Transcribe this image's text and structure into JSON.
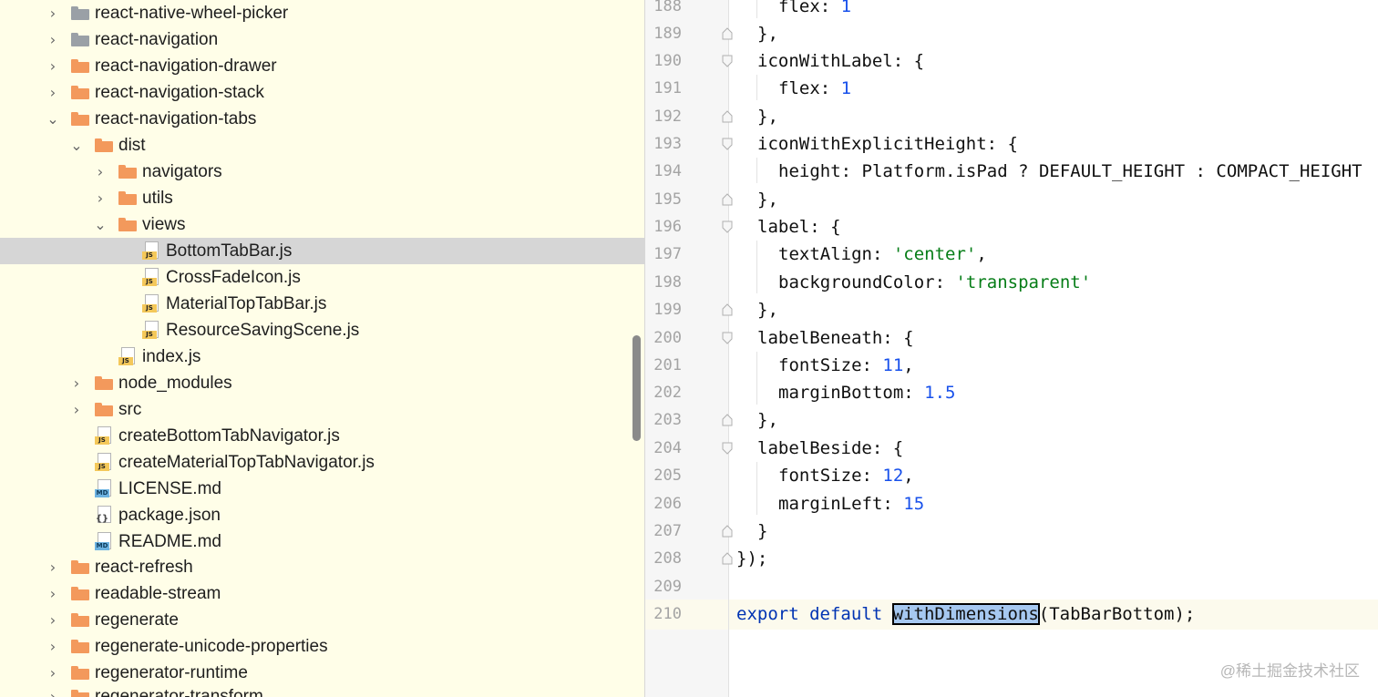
{
  "project_tree": {
    "items": [
      {
        "label": "react-native-wheel-picker",
        "icon": "folder-gray",
        "chevron": "collapsed"
      },
      {
        "label": "react-navigation",
        "icon": "folder-gray",
        "chevron": "collapsed"
      },
      {
        "label": "react-navigation-drawer",
        "icon": "folder",
        "chevron": "collapsed"
      },
      {
        "label": "react-navigation-stack",
        "icon": "folder",
        "chevron": "collapsed"
      },
      {
        "label": "react-navigation-tabs",
        "icon": "folder",
        "chevron": "expanded"
      },
      {
        "label": "dist",
        "icon": "folder",
        "chevron": "expanded"
      },
      {
        "label": "navigators",
        "icon": "folder",
        "chevron": "collapsed"
      },
      {
        "label": "utils",
        "icon": "folder",
        "chevron": "collapsed"
      },
      {
        "label": "views",
        "icon": "folder",
        "chevron": "expanded"
      },
      {
        "label": "BottomTabBar.js",
        "icon": "js-file",
        "chevron": "none",
        "selected": true
      },
      {
        "label": "CrossFadeIcon.js",
        "icon": "js-file",
        "chevron": "none"
      },
      {
        "label": "MaterialTopTabBar.js",
        "icon": "js-file",
        "chevron": "none"
      },
      {
        "label": "ResourceSavingScene.js",
        "icon": "js-file",
        "chevron": "none"
      },
      {
        "label": "index.js",
        "icon": "js-file",
        "chevron": "none"
      },
      {
        "label": "node_modules",
        "icon": "folder",
        "chevron": "collapsed"
      },
      {
        "label": "src",
        "icon": "folder",
        "chevron": "collapsed"
      },
      {
        "label": "createBottomTabNavigator.js",
        "icon": "js-file",
        "chevron": "none"
      },
      {
        "label": "createMaterialTopTabNavigator.js",
        "icon": "js-file",
        "chevron": "none"
      },
      {
        "label": "LICENSE.md",
        "icon": "md-file",
        "chevron": "none"
      },
      {
        "label": "package.json",
        "icon": "json-file",
        "chevron": "none"
      },
      {
        "label": "README.md",
        "icon": "md-file",
        "chevron": "none"
      },
      {
        "label": "react-refresh",
        "icon": "folder",
        "chevron": "collapsed"
      },
      {
        "label": "readable-stream",
        "icon": "folder",
        "chevron": "collapsed"
      },
      {
        "label": "regenerate",
        "icon": "folder",
        "chevron": "collapsed"
      },
      {
        "label": "regenerate-unicode-properties",
        "icon": "folder",
        "chevron": "collapsed"
      },
      {
        "label": "regenerator-runtime",
        "icon": "folder",
        "chevron": "collapsed"
      },
      {
        "label": "regenerator-transform",
        "icon": "folder",
        "chevron": "collapsed"
      }
    ]
  },
  "editor": {
    "lines": [
      {
        "num": "188",
        "text": "flex: 1"
      },
      {
        "num": "189",
        "text": "},"
      },
      {
        "num": "190",
        "text": "iconWithLabel: {"
      },
      {
        "num": "191",
        "text": "flex: 1"
      },
      {
        "num": "192",
        "text": "},"
      },
      {
        "num": "193",
        "text": "iconWithExplicitHeight: {"
      },
      {
        "num": "194",
        "text": "height: Platform.isPad ? DEFAULT_HEIGHT : COMPACT_HEIGHT"
      },
      {
        "num": "195",
        "text": "},"
      },
      {
        "num": "196",
        "text": "label: {"
      },
      {
        "num": "197",
        "text": "textAlign: 'center',"
      },
      {
        "num": "198",
        "text": "backgroundColor: 'transparent'"
      },
      {
        "num": "199",
        "text": "},"
      },
      {
        "num": "200",
        "text": "labelBeneath: {"
      },
      {
        "num": "201",
        "text": "fontSize: 11,"
      },
      {
        "num": "202",
        "text": "marginBottom: 1.5"
      },
      {
        "num": "203",
        "text": "},"
      },
      {
        "num": "204",
        "text": "labelBeside: {"
      },
      {
        "num": "205",
        "text": "fontSize: 12,"
      },
      {
        "num": "206",
        "text": "marginLeft: 15"
      },
      {
        "num": "207",
        "text": "}"
      },
      {
        "num": "208",
        "text": "});"
      },
      {
        "num": "209",
        "text": ""
      },
      {
        "num": "210",
        "text": "export default withDimensions(TabBarBottom);"
      }
    ],
    "highlighted_word": "withDimensions"
  },
  "watermark": "@稀土掘金技术社区",
  "colors": {
    "tree_background": "#fffee8",
    "selection": "#d6d6d6",
    "folder": "#f3995c",
    "folder_gray": "#9aa0a6",
    "keyword": "#0033b3",
    "number": "#1750eb",
    "string": "#067d17"
  }
}
